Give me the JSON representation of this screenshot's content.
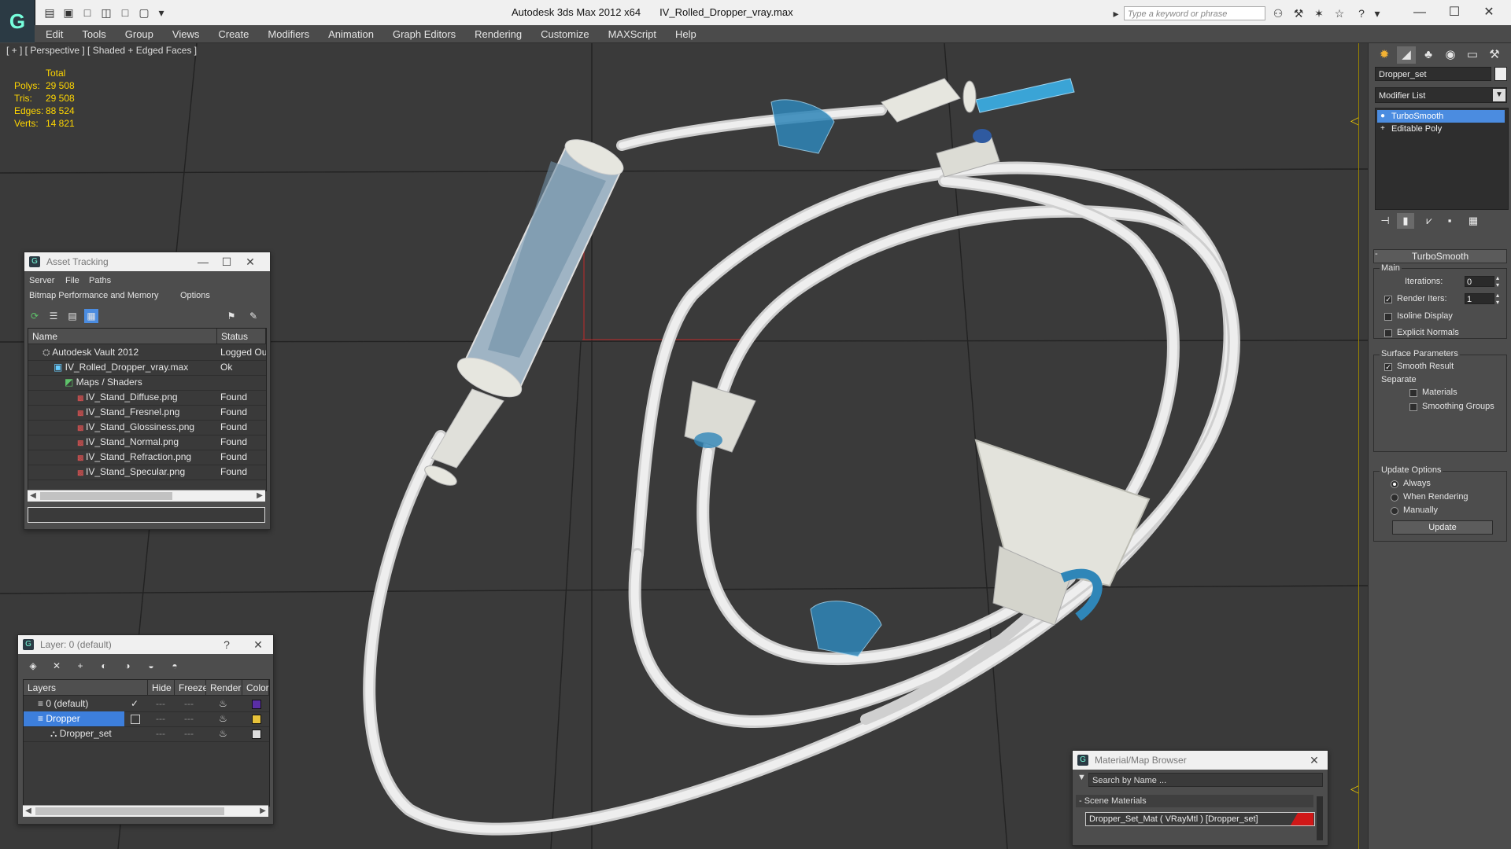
{
  "app": {
    "title": "Autodesk 3ds Max  2012 x64",
    "file": "IV_Rolled_Dropper_vray.max",
    "search_placeholder": "Type a keyword or phrase",
    "logo_glyph": "G"
  },
  "menu": [
    "Edit",
    "Tools",
    "Group",
    "Views",
    "Create",
    "Modifiers",
    "Animation",
    "Graph Editors",
    "Rendering",
    "Customize",
    "MAXScript",
    "Help"
  ],
  "viewport": {
    "label": "[ + ] [ Perspective ] [ Shaded + Edged Faces ]",
    "stats": {
      "header": "Total",
      "rows": [
        {
          "label": "Polys:",
          "value": "29 508"
        },
        {
          "label": "Tris:",
          "value": "29 508"
        },
        {
          "label": "Edges:",
          "value": "88 524"
        },
        {
          "label": "Verts:",
          "value": "14 821"
        }
      ]
    },
    "stats_color": "#ffd600"
  },
  "command_panel": {
    "object_name": "Dropper_set",
    "modifier_list": "Modifier List",
    "stack": [
      {
        "label": "TurboSmooth",
        "selected": true
      },
      {
        "label": "Editable Poly",
        "selected": false
      }
    ],
    "turbosmooth": {
      "title": "TurboSmooth",
      "main_label": "Main",
      "iterations_label": "Iterations:",
      "iterations_value": "0",
      "render_iters_label": "Render Iters:",
      "render_iters_value": "1",
      "isoline_label": "Isoline Display",
      "explicit_label": "Explicit Normals",
      "surface_label": "Surface Parameters",
      "smooth_result_label": "Smooth Result",
      "separate_label": "Separate",
      "materials_label": "Materials",
      "smoothing_groups_label": "Smoothing Groups",
      "update_options_label": "Update Options",
      "always_label": "Always",
      "when_rendering_label": "When Rendering",
      "manually_label": "Manually",
      "update_button": "Update"
    }
  },
  "asset_tracking": {
    "title": "Asset Tracking",
    "menu1": [
      "Server",
      "File",
      "Paths"
    ],
    "menu2": [
      "Bitmap Performance and Memory",
      "Options"
    ],
    "columns": [
      "Name",
      "Status"
    ],
    "rows": [
      {
        "name": "Autodesk Vault 2012",
        "status": "Logged Ou",
        "indent": 1
      },
      {
        "name": "IV_Rolled_Dropper_vray.max",
        "status": "Ok",
        "indent": 2
      },
      {
        "name": "Maps / Shaders",
        "status": "",
        "indent": 3
      },
      {
        "name": "IV_Stand_Diffuse.png",
        "status": "Found",
        "indent": 4
      },
      {
        "name": "IV_Stand_Fresnel.png",
        "status": "Found",
        "indent": 4
      },
      {
        "name": "IV_Stand_Glossiness.png",
        "status": "Found",
        "indent": 4
      },
      {
        "name": "IV_Stand_Normal.png",
        "status": "Found",
        "indent": 4
      },
      {
        "name": "IV_Stand_Refraction.png",
        "status": "Found",
        "indent": 4
      },
      {
        "name": "IV_Stand_Specular.png",
        "status": "Found",
        "indent": 4
      }
    ]
  },
  "layer_window": {
    "title": "Layer: 0 (default)",
    "help": "?",
    "columns": [
      "Layers",
      "Hide",
      "Freeze",
      "Render",
      "Color"
    ],
    "rows": [
      {
        "name": "0 (default)",
        "selected": false,
        "color": "#5a2ea6"
      },
      {
        "name": "Dropper",
        "selected": true,
        "color": "#e8c33a"
      },
      {
        "name": "Dropper_set",
        "selected": false,
        "color": "#dddddd"
      }
    ]
  },
  "material_browser": {
    "title": "Material/Map Browser",
    "search_placeholder": "Search by Name ...",
    "group_label": "- Scene Materials",
    "item": "Dropper_Set_Mat  ( VRayMtl ) [Dropper_set]"
  }
}
